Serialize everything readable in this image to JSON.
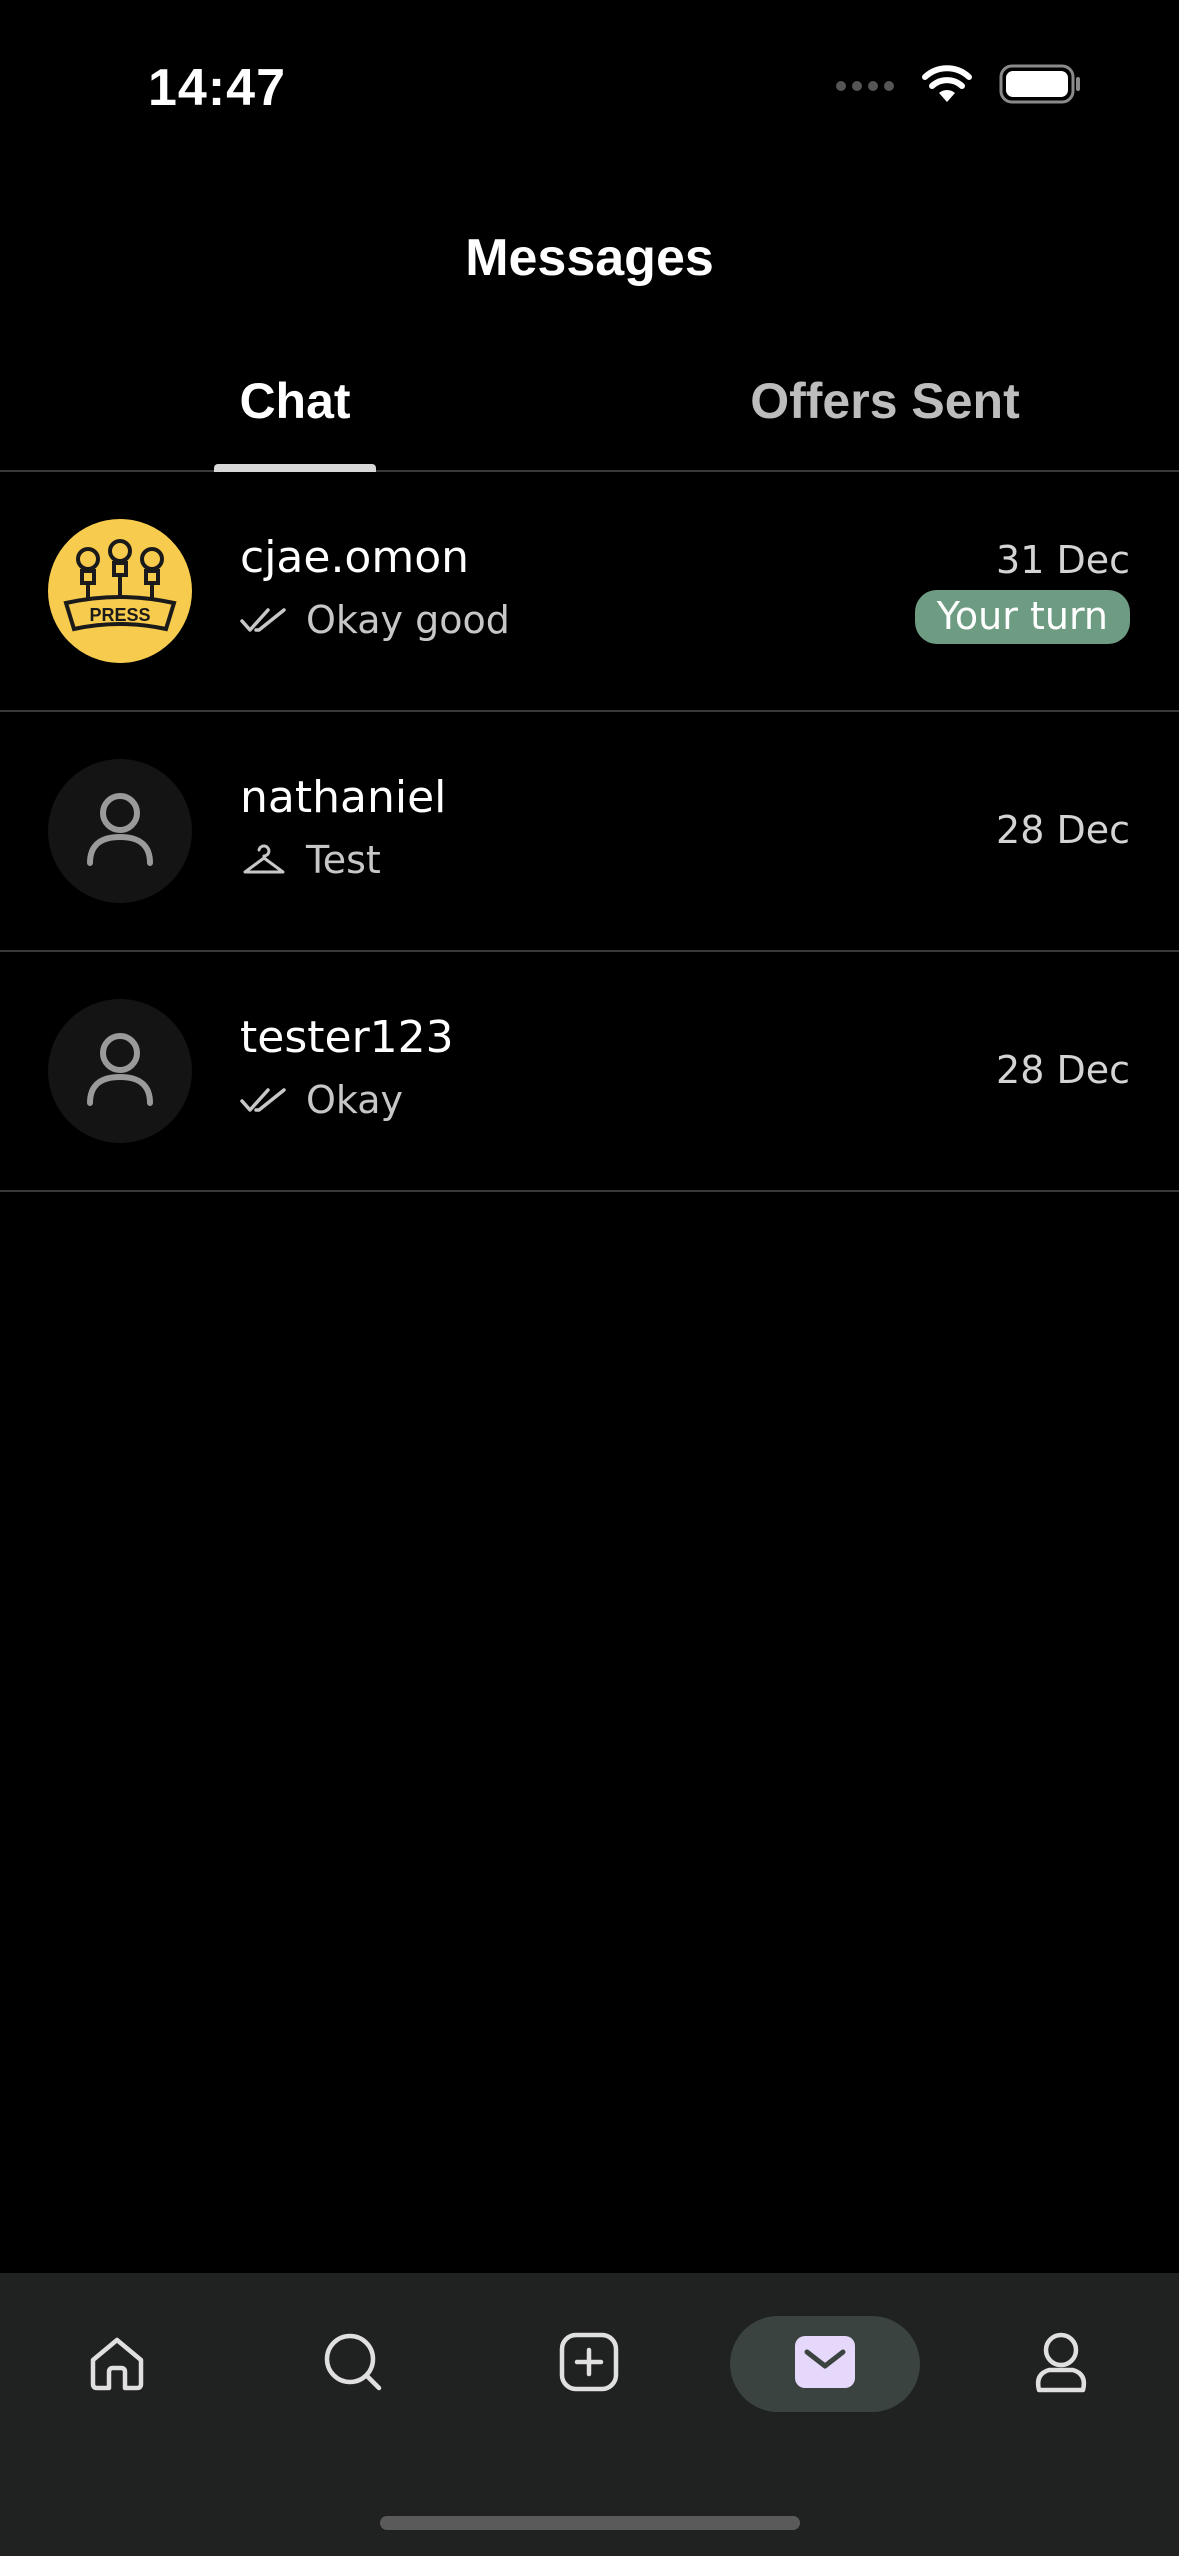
{
  "status_bar": {
    "time": "14:47",
    "icons": [
      "signal-dots-icon",
      "wifi-icon",
      "battery-icon"
    ]
  },
  "header": {
    "title": "Messages"
  },
  "tabs": [
    {
      "label": "Chat",
      "active": true
    },
    {
      "label": "Offers Sent",
      "active": false
    }
  ],
  "conversations": [
    {
      "name": "cjae.omon",
      "preview": "Okay good",
      "preview_icon": "double-check-icon",
      "date": "31 Dec",
      "badge": "Your turn",
      "avatar": "press-avatar",
      "avatar_text": "PRESS"
    },
    {
      "name": "nathaniel",
      "preview": "Test",
      "preview_icon": "hanger-icon",
      "date": "28 Dec",
      "avatar": "default-avatar"
    },
    {
      "name": "tester123",
      "preview": "Okay",
      "preview_icon": "double-check-icon",
      "date": "28 Dec",
      "avatar": "default-avatar"
    }
  ],
  "bottom_nav": [
    {
      "icon": "home-icon",
      "active": false
    },
    {
      "icon": "search-icon",
      "active": false
    },
    {
      "icon": "add-listing-icon",
      "active": false
    },
    {
      "icon": "messages-icon",
      "active": true
    },
    {
      "icon": "profile-icon",
      "active": false
    }
  ],
  "colors": {
    "badge": "#6e9c82",
    "press_avatar": "#f7cb4d",
    "nav_active": "#3a4340",
    "messages_icon": "#e6d8fb"
  }
}
